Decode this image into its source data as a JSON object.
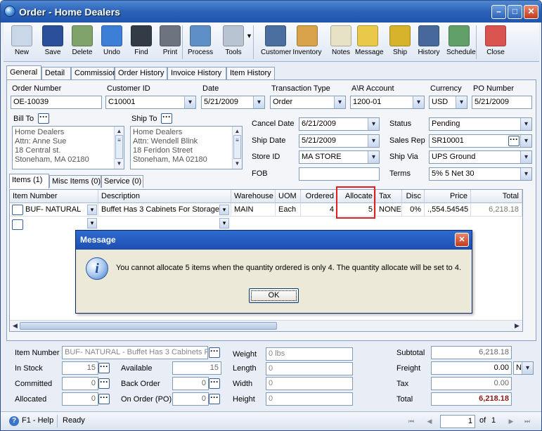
{
  "window": {
    "title": "Order - Home Dealers"
  },
  "toolbar": [
    {
      "label": "New",
      "icon": "new-document-icon",
      "color": "#c9d7e8"
    },
    {
      "label": "Save",
      "icon": "floppy-disk-icon",
      "color": "#2b4f9a"
    },
    {
      "label": "Delete",
      "icon": "recycle-bin-icon",
      "color": "#7fa36a"
    },
    {
      "label": "Undo",
      "icon": "undo-arrow-icon",
      "color": "#3d7fd6"
    },
    {
      "label": "Find",
      "icon": "binoculars-icon",
      "color": "#333b47"
    },
    {
      "label": "Print",
      "icon": "printer-icon",
      "color": "#6d7480"
    },
    {
      "label": "Process",
      "icon": "process-icon",
      "color": "#5e8fc7"
    },
    {
      "label": "Tools",
      "icon": "tools-icon",
      "color": "#b9c4d3"
    },
    {
      "label": "Customer",
      "icon": "customer-icon",
      "color": "#4a6f9f"
    },
    {
      "label": "Inventory",
      "icon": "inventory-boxes-icon",
      "color": "#d7a24a"
    },
    {
      "label": "Notes",
      "icon": "notes-icon",
      "color": "#e7e2c6"
    },
    {
      "label": "Message",
      "icon": "message-icon",
      "color": "#e9c84a"
    },
    {
      "label": "Ship",
      "icon": "forklift-icon",
      "color": "#d7b32c"
    },
    {
      "label": "History",
      "icon": "history-icon",
      "color": "#46689a"
    },
    {
      "label": "Schedule",
      "icon": "schedule-icon",
      "color": "#62a06a"
    },
    {
      "label": "Close",
      "icon": "close-form-icon",
      "color": "#d9534f"
    }
  ],
  "tabs": [
    "General",
    "Detail",
    "Commission",
    "Order History",
    "Invoice History",
    "Item History"
  ],
  "header": {
    "order_number_label": "Order Number",
    "order_number": "OE-10039",
    "customer_id_label": "Customer ID",
    "customer_id": "C10001",
    "date_label": "Date",
    "date": "5/21/2009",
    "transaction_type_label": "Transaction Type",
    "transaction_type": "Order",
    "ar_account_label": "A\\R Account",
    "ar_account": "1200-01",
    "currency_label": "Currency",
    "currency": "USD",
    "po_number_label": "PO Number",
    "po_number": "5/21/2009"
  },
  "bill_to": {
    "label": "Bill To",
    "lines": [
      "Home Dealers",
      "Attn: Anne Sue",
      "18 Central st.",
      "Stoneham, MA 02180"
    ]
  },
  "ship_to": {
    "label": "Ship To",
    "lines": [
      "Home Dealers",
      "Attn: Wendell Blink",
      "18 Feridon Street",
      "Stoneham, MA 02180"
    ]
  },
  "dates": {
    "cancel_date_label": "Cancel Date",
    "cancel_date": "6/21/2009",
    "ship_date_label": "Ship Date",
    "ship_date": "5/21/2009",
    "store_id_label": "Store ID",
    "store_id": "MA STORE",
    "fob_label": "FOB",
    "fob": ""
  },
  "terms": {
    "status_label": "Status",
    "status": "Pending",
    "sales_rep_label": "Sales Rep",
    "sales_rep": "SR10001",
    "ship_via_label": "Ship Via",
    "ship_via": "UPS Ground",
    "terms_label": "Terms",
    "terms": "5% 5 Net 30"
  },
  "item_tabs": [
    "Items (1)",
    "Misc Items (0)",
    "Service (0)"
  ],
  "grid": {
    "columns": [
      "Item Number",
      "Description",
      "Warehouse",
      "UOM",
      "Ordered",
      "Allocate",
      "Tax",
      "Disc",
      "Price",
      "Total"
    ],
    "rows": [
      [
        "BUF- NATURAL",
        "Buffet Has 3 Cabinets For Storage",
        "MAIN",
        "Each",
        "4",
        "5",
        "NONE",
        "0%",
        ".,554.54545",
        "6,218.18"
      ]
    ]
  },
  "dialog": {
    "title": "Message",
    "message": "You cannot allocate 5 items when the quantity ordered is only 4. The quantity allocate will  be set to 4.",
    "ok": "OK"
  },
  "details": {
    "item_number_label": "Item Number",
    "item_number": "BUF- NATURAL - Buffet Has 3 Cabinets For",
    "in_stock_label": "In Stock",
    "in_stock": "15",
    "available_label": "Available",
    "available": "15",
    "committed_label": "Committed",
    "committed": "0",
    "back_order_label": "Back Order",
    "back_order": "0",
    "allocated_label": "Allocated",
    "allocated": "0",
    "on_order_label": "On Order (PO)",
    "on_order": "0",
    "weight_label": "Weight",
    "weight": "0 lbs",
    "length_label": "Length",
    "length": "0",
    "width_label": "Width",
    "width": "0",
    "height_label": "Height",
    "height": "0"
  },
  "totals": {
    "subtotal_label": "Subtotal",
    "subtotal": "6,218.18",
    "freight_label": "Freight",
    "freight": "0.00",
    "freight_code": "N",
    "tax_label": "Tax",
    "tax": "0.00",
    "total_label": "Total",
    "total": "6,218.18"
  },
  "status": {
    "help": "F1 - Help",
    "state": "Ready",
    "page": "1",
    "of_label": "of",
    "page_count": "1"
  }
}
